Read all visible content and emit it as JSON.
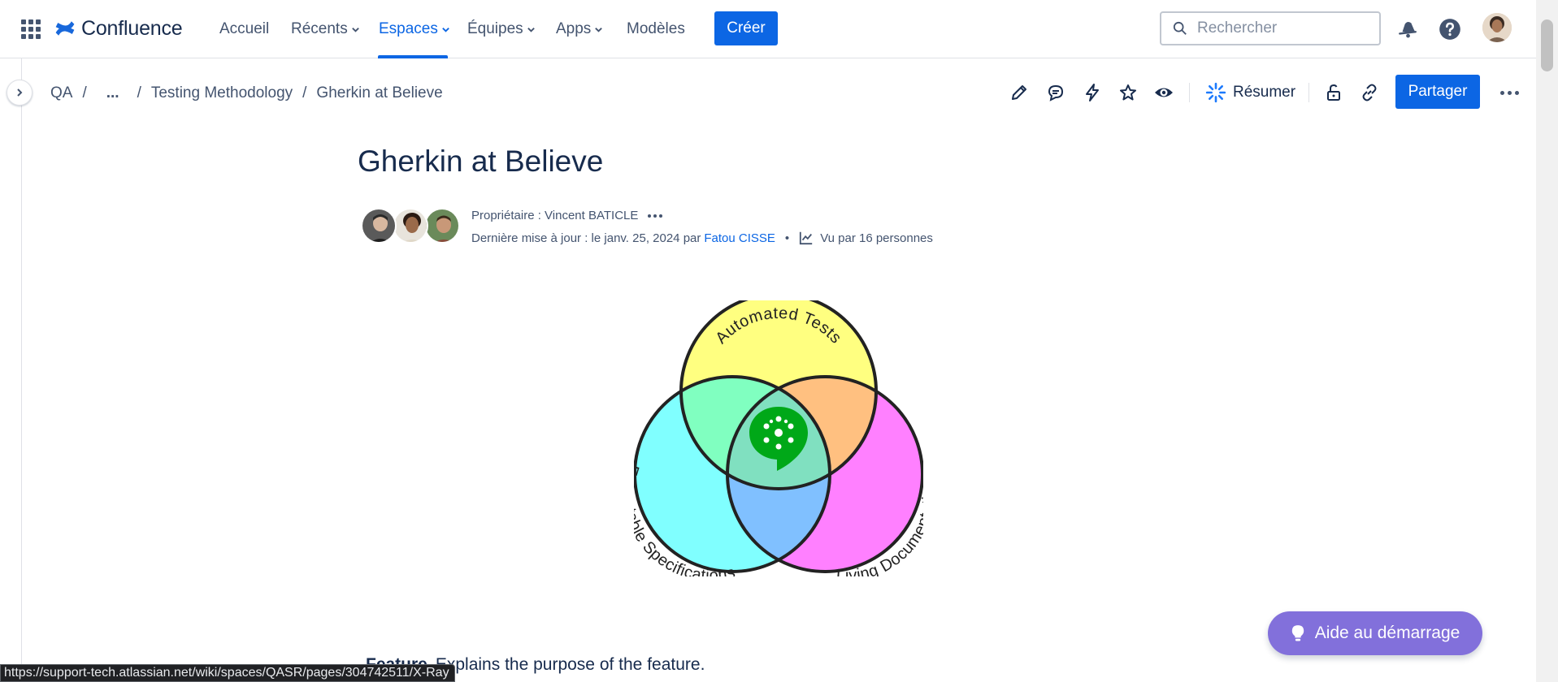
{
  "topnav": {
    "app_name": "Confluence",
    "items": [
      {
        "label": "Accueil",
        "has_menu": false
      },
      {
        "label": "Récents",
        "has_menu": true
      },
      {
        "label": "Espaces",
        "has_menu": true,
        "active": true
      },
      {
        "label": "Équipes",
        "has_menu": true
      },
      {
        "label": "Apps",
        "has_menu": true
      },
      {
        "label": "Modèles",
        "has_menu": false
      }
    ],
    "create_label": "Créer",
    "search_placeholder": "Rechercher",
    "icons": [
      "apps-grid-icon",
      "notifications-icon",
      "help-icon",
      "avatar"
    ]
  },
  "breadcrumb": {
    "items": [
      "QA",
      "...",
      "Testing Methodology",
      "Gherkin at Believe"
    ],
    "separator": "/"
  },
  "toolbar": {
    "icons": [
      "edit-icon",
      "comment-icon",
      "automation-icon",
      "star-icon",
      "watch-icon",
      "restrictions-icon",
      "copy-link-icon",
      "more-icon"
    ],
    "summarize_label": "Résumer",
    "share_label": "Partager"
  },
  "page": {
    "title": "Gherkin at Believe",
    "owner_prefix": "Propriétaire : ",
    "owner_name": "Vincent BATICLE",
    "updated_prefix": "Dernière mise à jour : le janv. 25, 2024 par",
    "updated_by": "Fatou CISSE",
    "separator": "•",
    "views": "Vu par 16 personnes"
  },
  "venn": {
    "labels": [
      "Automated Tests",
      "Executable Specifications",
      "Living Documentation"
    ],
    "colors": {
      "top": "#ffff80",
      "left": "#80ffff",
      "right": "#ff80ff",
      "top_left": "#80ffc0",
      "top_right": "#ffc080",
      "bottom": "#80c0ff",
      "center": "#80e0c0",
      "logo": "#00a818"
    }
  },
  "body": {
    "term": "Feature",
    "text": "Explains the purpose of the feature."
  },
  "help_button": {
    "label": "Aide au démarrage"
  },
  "status_bar": {
    "url": "https://support-tech.atlassian.net/wiki/spaces/QASR/pages/304742511/X-Ray"
  },
  "colors": {
    "primary": "#0c66e4",
    "help": "#8270db",
    "text": "#172b4d",
    "subtle": "#44546f"
  }
}
